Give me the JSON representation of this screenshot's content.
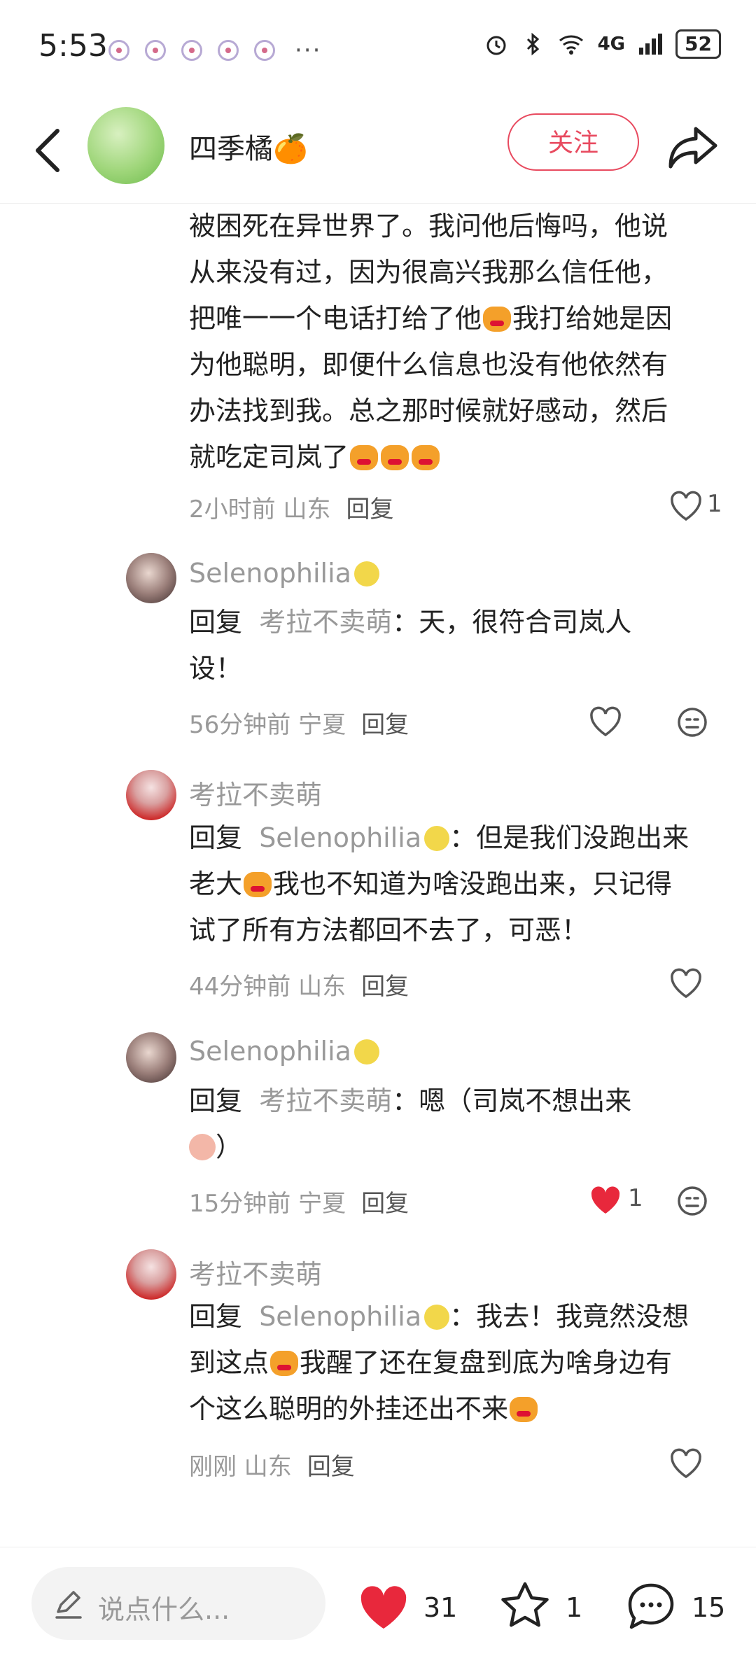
{
  "status_bar": {
    "time": "5:53",
    "more": "···",
    "network": "4G",
    "battery": "52"
  },
  "header": {
    "username": "四季橘🍊",
    "follow_label": "关注"
  },
  "comment_top": {
    "lines": [
      "被困死在异世界了。我问他后悔吗，他说",
      "从来没有过，因为很高兴我那么信任他，",
      "把唯一一个电话打给了他",
      "我打给她是因",
      "为他聪明，即便什么信息也没有他依然有",
      "办法找到我。总之那时候就好感动，然后",
      "就吃定司岚了"
    ],
    "time_location": "2小时前 山东",
    "reply_label": "回复",
    "like_count": "1"
  },
  "replies": [
    {
      "name": "Selenophilia",
      "reply_prefix": "回复",
      "reply_to": "考拉不卖萌",
      "text_line1": "：天，很符合司岚人",
      "text_line2": "设！",
      "time_location": "56分钟前 宁夏",
      "reply_label": "回复"
    },
    {
      "name": "考拉不卖萌",
      "reply_prefix": "回复",
      "reply_to": "Selenophilia",
      "text_line1": "：但是我们没跑出来",
      "text_line2a": "老大",
      "text_line2b": "我也不知道为啥没跑出来，只记得",
      "text_line3": "试了所有方法都回不去了，可恶！",
      "time_location": "44分钟前 山东",
      "reply_label": "回复"
    },
    {
      "name": "Selenophilia",
      "reply_prefix": "回复",
      "reply_to": "考拉不卖萌",
      "text_line1": "：嗯（司岚不想出来",
      "text_line2": "）",
      "time_location": "15分钟前 宁夏",
      "reply_label": "回复",
      "like_count": "1"
    },
    {
      "name": "考拉不卖萌",
      "reply_prefix": "回复",
      "reply_to": "Selenophilia",
      "text_line1": "：我去！我竟然没想",
      "text_line2a": "到这点",
      "text_line2b": "我醒了还在复盘到底为啥身边有",
      "text_line3": "个这么聪明的外挂还出不来",
      "time_location": "刚刚 山东",
      "reply_label": "回复"
    }
  ],
  "bottom_bar": {
    "input_placeholder": "说点什么...",
    "like_count": "31",
    "star_count": "1",
    "comment_count": "15"
  },
  "colors": {
    "accent": "#e84a5f",
    "like_red": "#e8283c",
    "muted": "#999999"
  }
}
